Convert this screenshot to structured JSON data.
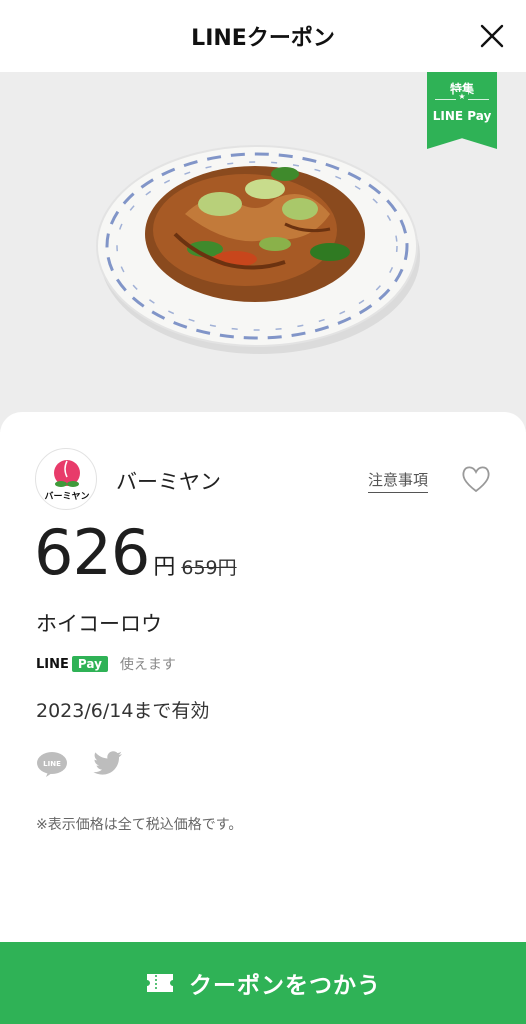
{
  "header": {
    "title": "LINEクーポン",
    "close_icon": "close-icon"
  },
  "hero": {
    "ribbon_top": "特集",
    "ribbon_star": "★",
    "ribbon_bottom": "LINE Pay",
    "ribbon_color": "#2fb256"
  },
  "shop": {
    "name": "バーミヤン",
    "logo_text": "バーミヤン",
    "notes_label": "注意事項",
    "favorite_icon": "heart-icon"
  },
  "price": {
    "current": "626",
    "yen": "円",
    "original": "659円"
  },
  "product": {
    "name": "ホイコーロウ"
  },
  "payment": {
    "line": "LINE",
    "pay": "Pay",
    "available_text": "使えます"
  },
  "validity": "2023/6/14まで有効",
  "share": {
    "line_icon": "line-share-icon",
    "line_text": "LINE",
    "twitter_icon": "twitter-icon"
  },
  "tax_note": "※表示価格は全て税込価格です。",
  "cta": {
    "label": "クーポンをつかう",
    "icon": "ticket-icon",
    "color": "#2fb256"
  }
}
